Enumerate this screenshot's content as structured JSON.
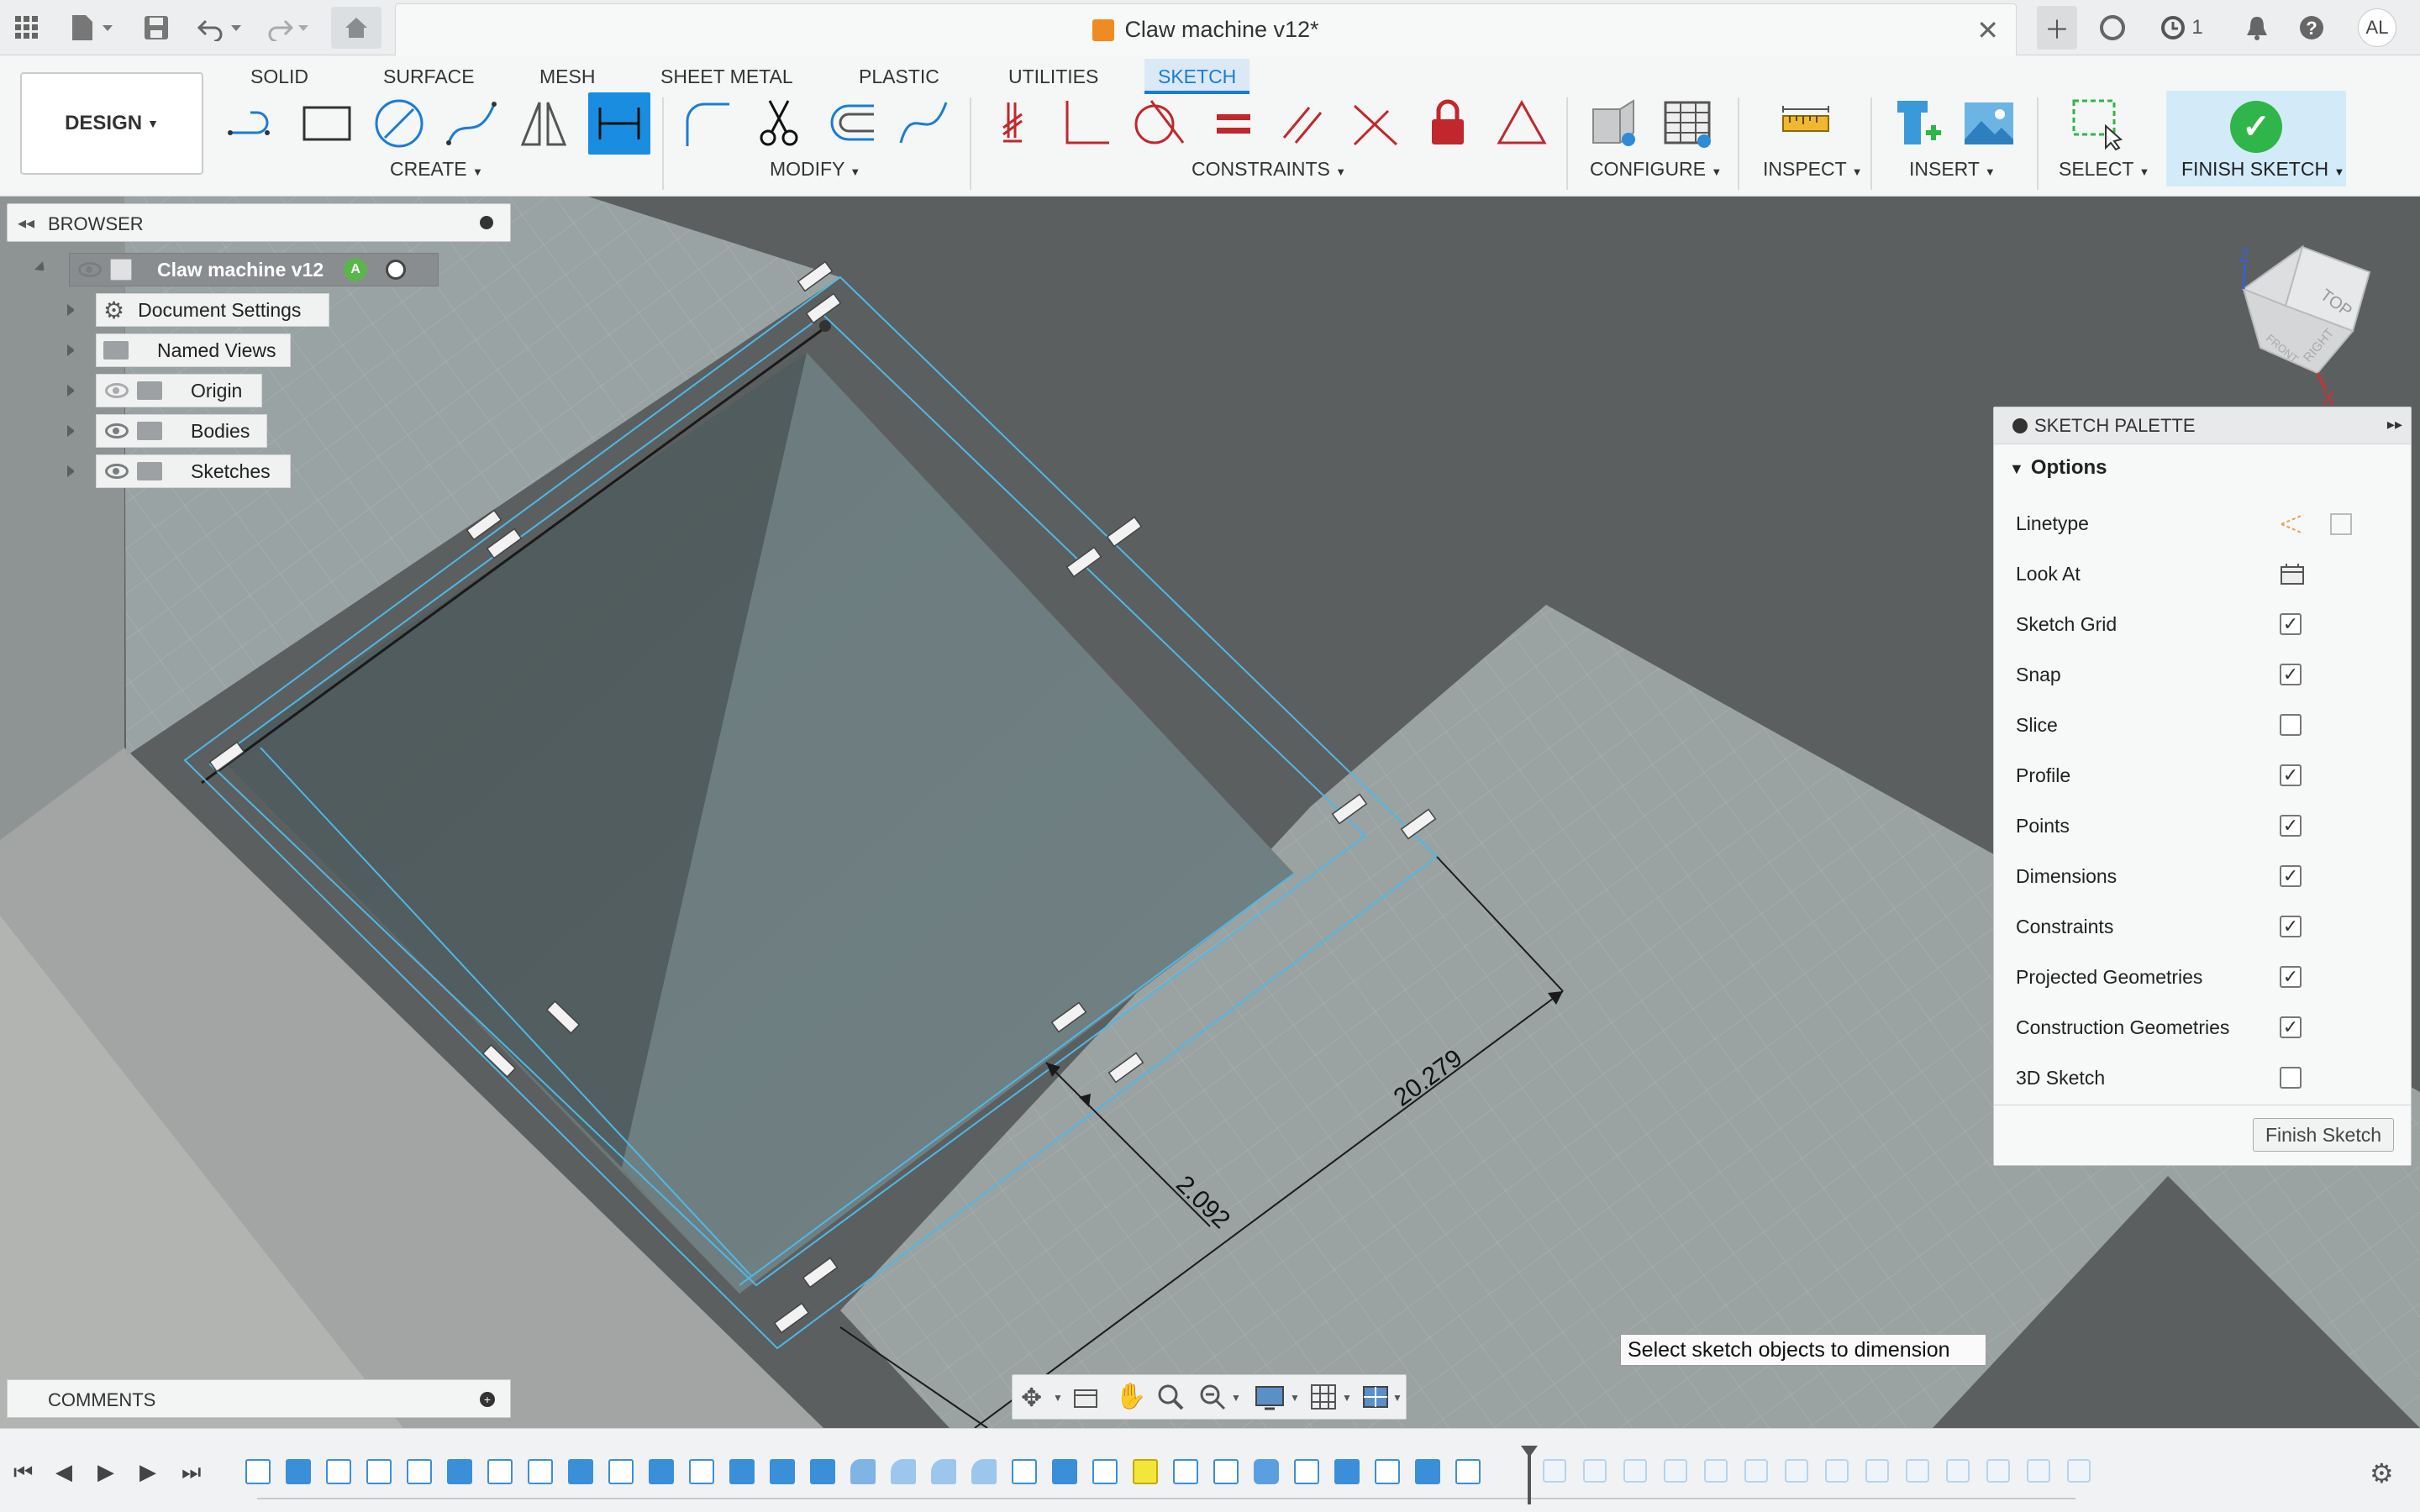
{
  "app": {
    "document_title": "Claw machine v12*",
    "job_count": "1",
    "user_initials": "AL"
  },
  "ribbon": {
    "workspace": "DESIGN",
    "tabs": [
      "SOLID",
      "SURFACE",
      "MESH",
      "SHEET METAL",
      "PLASTIC",
      "UTILITIES",
      "SKETCH"
    ],
    "active_tab": "SKETCH",
    "groups": {
      "create": "CREATE",
      "modify": "MODIFY",
      "constraints": "CONSTRAINTS",
      "configure": "CONFIGURE",
      "inspect": "INSPECT",
      "insert": "INSERT",
      "select": "SELECT",
      "finish": "FINISH SKETCH"
    }
  },
  "browser": {
    "title": "BROWSER",
    "root": "Claw machine v12",
    "items": [
      "Document Settings",
      "Named Views",
      "Origin",
      "Bodies",
      "Sketches"
    ]
  },
  "viewcube": {
    "top": "TOP",
    "front": "FRONT",
    "right": "RIGHT",
    "axis_z": "Z",
    "axis_x": "X"
  },
  "sketch_palette": {
    "title": "SKETCH PALETTE",
    "section": "Options",
    "options": [
      {
        "label": "Linetype",
        "control": "linetype"
      },
      {
        "label": "Look At",
        "control": "lookat"
      },
      {
        "label": "Sketch Grid",
        "checked": true
      },
      {
        "label": "Snap",
        "checked": true
      },
      {
        "label": "Slice",
        "checked": false
      },
      {
        "label": "Profile",
        "checked": true
      },
      {
        "label": "Points",
        "checked": true
      },
      {
        "label": "Dimensions",
        "checked": true
      },
      {
        "label": "Constraints",
        "checked": true
      },
      {
        "label": "Projected Geometries",
        "checked": true
      },
      {
        "label": "Construction Geometries",
        "checked": true
      },
      {
        "label": "3D Sketch",
        "checked": false
      }
    ],
    "finish_button": "Finish Sketch"
  },
  "dimensions": {
    "long": "20.279",
    "short": "2.092"
  },
  "tooltip": "Select sketch objects to dimension",
  "comments": {
    "title": "COMMENTS"
  },
  "colors": {
    "accent": "#1a8de0",
    "sketch_line": "#4fb8e8",
    "finish_green": "#2fb54a"
  }
}
